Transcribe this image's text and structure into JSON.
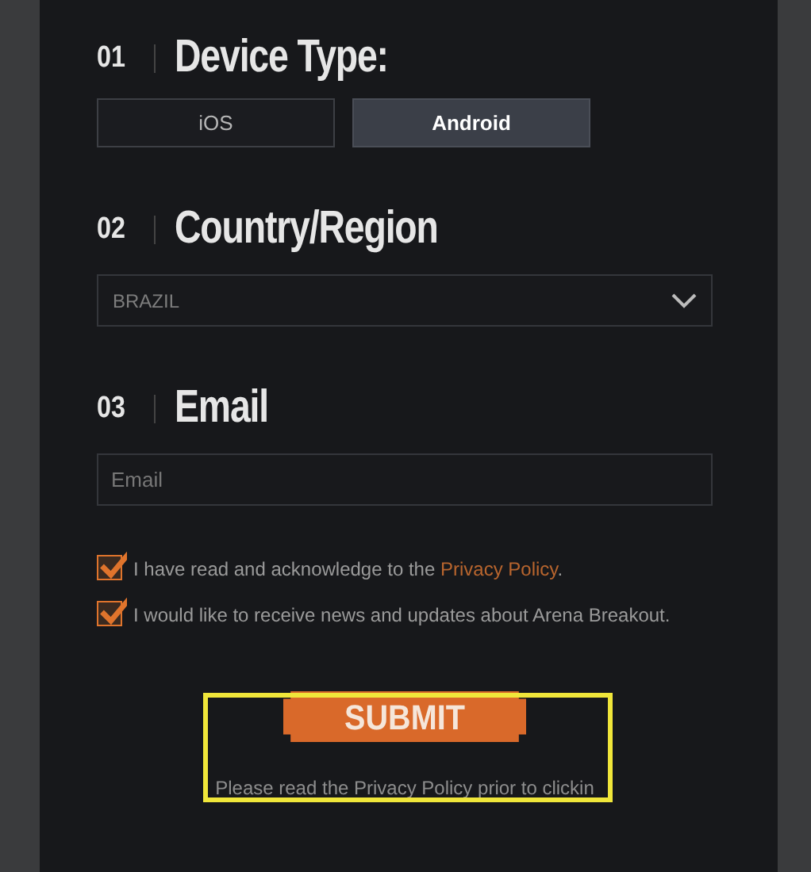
{
  "sections": [
    {
      "number": "01",
      "title": "Device Type:",
      "kind": "choice",
      "options": [
        {
          "label": "iOS",
          "selected": false
        },
        {
          "label": "Android",
          "selected": true
        }
      ]
    },
    {
      "number": "02",
      "title": "Country/Region",
      "kind": "select",
      "value": "BRAZIL"
    },
    {
      "number": "03",
      "title": "Email",
      "kind": "input",
      "placeholder": "Email"
    }
  ],
  "consents": [
    {
      "text": "I have read and acknowledge to the ",
      "link": "Privacy Policy",
      "suffix": ".",
      "checked": true
    },
    {
      "text": "I would like to receive news and updates about Arena Breakout.",
      "checked": true
    }
  ],
  "submit": {
    "label": "SUBMIT",
    "highlighted": true
  },
  "note": "Please read the Privacy Policy prior to clickin"
}
